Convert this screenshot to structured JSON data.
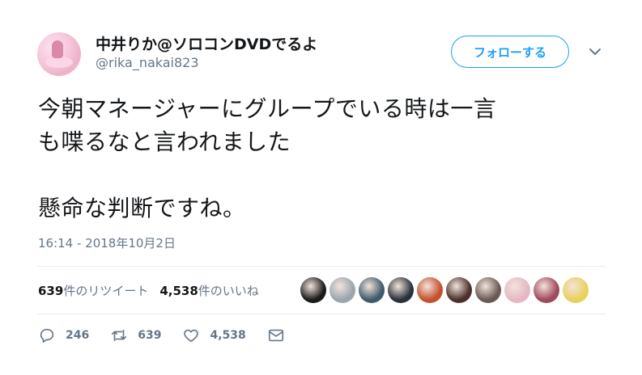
{
  "author": {
    "display_name": "中井りか@ソロコンDVDでるよ",
    "handle": "@rika_nakai823"
  },
  "follow_button": {
    "label": "フォローする"
  },
  "tweet": {
    "text": "今朝マネージャーにグループでいる時は一言\nも喋るなと言われました\n\n懸命な判断ですね。",
    "timestamp": "16:14 - 2018年10月2日"
  },
  "stats": {
    "retweets_count": "639",
    "retweets_label": "件のリツイート",
    "likes_count": "4,538",
    "likes_label": "件のいいね"
  },
  "likers": [
    {
      "name": "liker-1",
      "color": "#1b1b1b"
    },
    {
      "name": "liker-2",
      "color": "#9aa5ad"
    },
    {
      "name": "liker-3",
      "color": "#3f5a6a"
    },
    {
      "name": "liker-4",
      "color": "#29303a"
    },
    {
      "name": "liker-5",
      "color": "#c4502d"
    },
    {
      "name": "liker-6",
      "color": "#4a2f2b"
    },
    {
      "name": "liker-7",
      "color": "#6a5a55"
    },
    {
      "name": "liker-8",
      "color": "#e5b7c3"
    },
    {
      "name": "liker-9",
      "color": "#a0485d"
    },
    {
      "name": "liker-10",
      "color": "#e8d25a"
    }
  ],
  "actions": {
    "reply_count": "246",
    "retweet_count": "639",
    "like_count": "4,538"
  },
  "colors": {
    "accent": "#1da1f2",
    "muted": "#657786",
    "divider": "#e6ecf0"
  }
}
